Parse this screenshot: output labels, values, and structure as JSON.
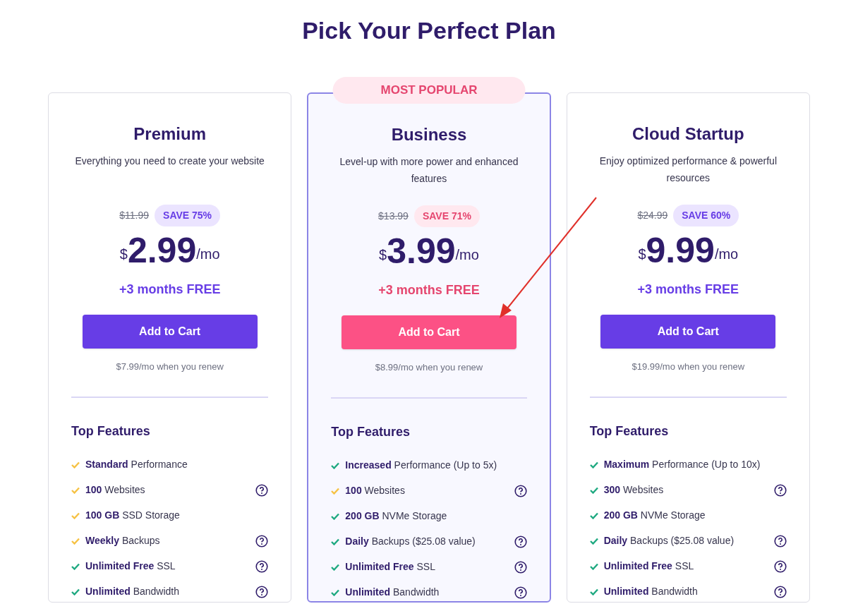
{
  "title": "Pick Your Perfect Plan",
  "plans": [
    {
      "name": "Premium",
      "featured": false,
      "description": "Everything you need to create your website",
      "old_price": "$11.99",
      "save": "SAVE 75%",
      "currency": "$",
      "price": "2.99",
      "period": "/mo",
      "bonus": "+3 months FREE",
      "button": "Add to Cart",
      "renew": "$7.99/mo when you renew",
      "features_title": "Top Features",
      "features": [
        {
          "text": "**Standard** Performance",
          "color": "#f6c244",
          "help": false
        },
        {
          "text": "**100** Websites",
          "color": "#f6c244",
          "help": true
        },
        {
          "text": "**100 GB** SSD Storage",
          "color": "#f6c244",
          "help": false
        },
        {
          "text": "**Weekly** Backups",
          "color": "#f6c244",
          "help": true
        },
        {
          "text": "**Unlimited Free** SSL",
          "color": "#1ea980",
          "help": true
        },
        {
          "text": "**Unlimited** Bandwidth",
          "color": "#1ea980",
          "help": true
        }
      ]
    },
    {
      "name": "Business",
      "featured": true,
      "badge": "MOST POPULAR",
      "description": "Level-up with more power and enhanced features",
      "old_price": "$13.99",
      "save": "SAVE 71%",
      "currency": "$",
      "price": "3.99",
      "period": "/mo",
      "bonus": "+3 months FREE",
      "button": "Add to Cart",
      "renew": "$8.99/mo when you renew",
      "features_title": "Top Features",
      "features": [
        {
          "text": "**Increased** Performance (Up to 5x)",
          "color": "#1ea980",
          "help": false
        },
        {
          "text": "**100** Websites",
          "color": "#f6c244",
          "help": true
        },
        {
          "text": "**200 GB** NVMe Storage",
          "color": "#1ea980",
          "help": false
        },
        {
          "text": "**Daily** Backups ($25.08 value)",
          "color": "#1ea980",
          "help": true
        },
        {
          "text": "**Unlimited Free** SSL",
          "color": "#1ea980",
          "help": true
        },
        {
          "text": "**Unlimited** Bandwidth",
          "color": "#1ea980",
          "help": true
        }
      ]
    },
    {
      "name": "Cloud Startup",
      "featured": false,
      "description": "Enjoy optimized performance & powerful resources",
      "old_price": "$24.99",
      "save": "SAVE 60%",
      "currency": "$",
      "price": "9.99",
      "period": "/mo",
      "bonus": "+3 months FREE",
      "button": "Add to Cart",
      "renew": "$19.99/mo when you renew",
      "features_title": "Top Features",
      "features": [
        {
          "text": "**Maximum** Performance (Up to 10x)",
          "color": "#1ea980",
          "help": false
        },
        {
          "text": "**300** Websites",
          "color": "#1ea980",
          "help": true
        },
        {
          "text": "**200 GB** NVMe Storage",
          "color": "#1ea980",
          "help": false
        },
        {
          "text": "**Daily** Backups ($25.08 value)",
          "color": "#1ea980",
          "help": true
        },
        {
          "text": "**Unlimited Free** SSL",
          "color": "#1ea980",
          "help": true
        },
        {
          "text": "**Unlimited** Bandwidth",
          "color": "#1ea980",
          "help": true
        }
      ]
    }
  ]
}
